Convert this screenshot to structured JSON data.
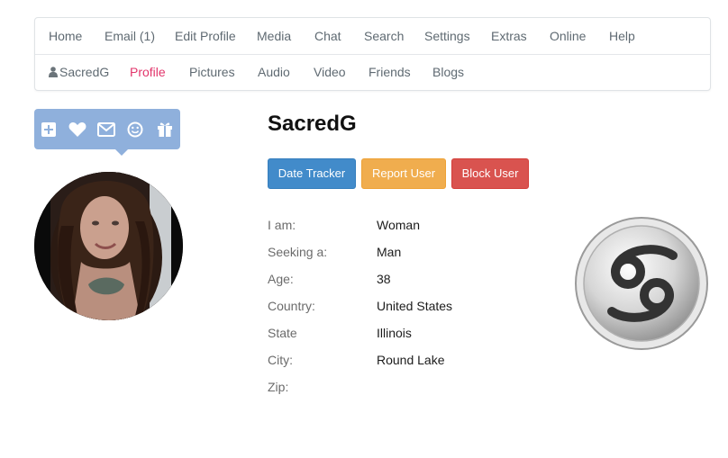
{
  "nav": {
    "primary": [
      {
        "label": "Home"
      },
      {
        "label": "Email (1)"
      },
      {
        "label": "Edit Profile"
      },
      {
        "label": "Media"
      },
      {
        "label": "Chat"
      },
      {
        "label": "Search"
      },
      {
        "label": "Settings"
      },
      {
        "label": "Extras"
      },
      {
        "label": "Online"
      },
      {
        "label": "Help"
      }
    ],
    "secondary": [
      {
        "label": "SacredG",
        "icon": "user-icon"
      },
      {
        "label": "Profile",
        "active": true
      },
      {
        "label": "Pictures"
      },
      {
        "label": "Audio"
      },
      {
        "label": "Video"
      },
      {
        "label": "Friends"
      },
      {
        "label": "Blogs"
      }
    ]
  },
  "action_bar": {
    "icons": [
      "add-icon",
      "heart-icon",
      "envelope-icon",
      "smile-icon",
      "gift-icon"
    ],
    "color": "#8fb0dc"
  },
  "profile": {
    "username": "SacredG",
    "buttons": {
      "date_tracker": "Date Tracker",
      "report_user": "Report User",
      "block_user": "Block User"
    },
    "fields": [
      {
        "label": "I am:",
        "value": "Woman"
      },
      {
        "label": "Seeking a:",
        "value": "Man"
      },
      {
        "label": "Age:",
        "value": "38"
      },
      {
        "label": "Country:",
        "value": "United States"
      },
      {
        "label": "State",
        "value": "Illinois"
      },
      {
        "label": "City:",
        "value": "Round Lake"
      },
      {
        "label": "Zip:",
        "value": ""
      }
    ],
    "zodiac_icon": "cancer-zodiac-icon"
  },
  "colors": {
    "active_link": "#e2356b",
    "btn_blue": "#428bca",
    "btn_orange": "#f0ad4e",
    "btn_red": "#d9534f"
  }
}
